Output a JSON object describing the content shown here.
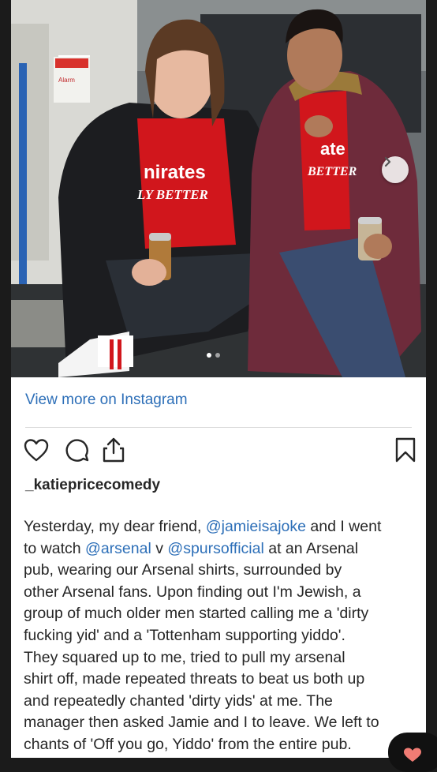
{
  "post": {
    "photo": {
      "alt_icon": "instagram-photo",
      "next_icon": "chevron-right-icon",
      "carousel": {
        "count": 2,
        "active_index": 0
      },
      "sign_alarm": "Alarm",
      "shirt_text_left_1": "nirates",
      "shirt_text_left_2": "LY BETTER",
      "shirt_text_right_1": "ate",
      "shirt_text_right_2": "BETTER"
    },
    "view_more": "View more on Instagram",
    "actions": {
      "like_icon": "heart-icon",
      "comment_icon": "comment-icon",
      "share_icon": "share-icon",
      "save_icon": "bookmark-icon"
    },
    "username": "_katiepricecomedy",
    "caption": [
      {
        "t": "Yesterday, my dear friend, "
      },
      {
        "t": "@jamieisajoke",
        "m": true
      },
      {
        "t": " and I went\nto watch "
      },
      {
        "t": "@arsenal",
        "m": true
      },
      {
        "t": " v "
      },
      {
        "t": "@spursofficial",
        "m": true
      },
      {
        "t": " at an Arsenal\npub, wearing our Arsenal shirts, surrounded by\nother Arsenal fans. Upon finding out I'm Jewish, a\ngroup of much older men started calling me a 'dirty\nfucking yid' and a 'Tottenham supporting yiddo'.\nThey squared up to me, tried to pull my arsenal\nshirt off, made repeated threats to beat us both up\nand repeatedly chanted 'dirty yids' at me. The\nmanager then asked Jamie and I to leave. We left to\nchants of 'Off you go, Yiddo' from the entire pub."
      }
    ]
  },
  "colors": {
    "link": "#2d6fb8",
    "text": "#262626",
    "arsenal_red": "#d1161c"
  }
}
